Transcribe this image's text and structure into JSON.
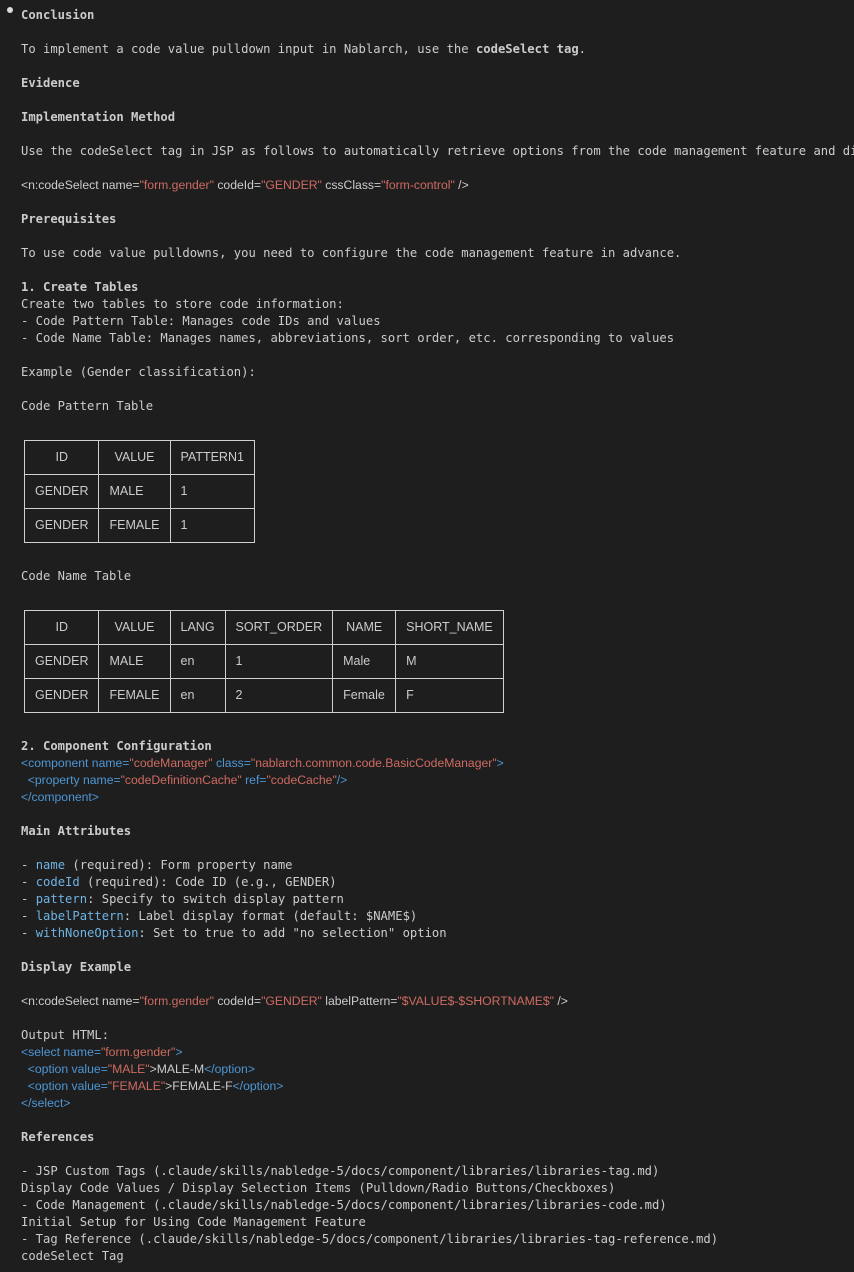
{
  "heading": "Conclusion",
  "intro": {
    "pre": "To implement a code value pulldown input in Nablarch, use the ",
    "tag": "codeSelect tag",
    "post": "."
  },
  "evidence": "Evidence",
  "impl_method": "Implementation Method",
  "impl_text": "Use the codeSelect tag in JSP as follows to automatically retrieve options from the code management feature and display",
  "code1": {
    "open": "<n:codeSelect name=",
    "v1": "\"form.gender\"",
    "a2": " codeId=",
    "v2": "\"GENDER\"",
    "a3": " cssClass=",
    "v3": "\"form-control\"",
    "close": " />"
  },
  "prerequisites": "Prerequisites",
  "prereq_text": "To use code value pulldowns, you need to configure the code management feature in advance.",
  "step1": "1. Create Tables",
  "step1_lines": [
    "Create two tables to store code information:",
    "- Code Pattern Table: Manages code IDs and values",
    "- Code Name Table: Manages names, abbreviations, sort order, etc. corresponding to values"
  ],
  "example_label": "Example (Gender classification):",
  "pattern_table": {
    "title": "Code Pattern Table",
    "headers": [
      "ID",
      "VALUE",
      "PATTERN1"
    ],
    "rows": [
      [
        "GENDER",
        "MALE",
        "1"
      ],
      [
        "GENDER",
        "FEMALE",
        "1"
      ]
    ]
  },
  "name_table": {
    "title": "Code Name Table",
    "headers": [
      "ID",
      "VALUE",
      "LANG",
      "SORT_ORDER",
      "NAME",
      "SHORT_NAME"
    ],
    "rows": [
      [
        "GENDER",
        "MALE",
        "en",
        "1",
        "Male",
        "M"
      ],
      [
        "GENDER",
        "FEMALE",
        "en",
        "2",
        "Female",
        "F"
      ]
    ]
  },
  "step2": "2. Component Configuration",
  "xml": {
    "l1_tag": "<component",
    "l1_a1": " name=",
    "l1_v1": "\"codeManager\"",
    "l1_a2": " class=",
    "l1_v2": "\"nablarch.common.code.BasicCodeManager\"",
    "l1_end": ">",
    "l2_tag": "  <property",
    "l2_a1": " name=",
    "l2_v1": "\"codeDefinitionCache\"",
    "l2_a2": " ref=",
    "l2_v2": "\"codeCache\"",
    "l2_end": "/>",
    "l3": "</component>"
  },
  "main_attrs": "Main Attributes",
  "attrs": [
    {
      "name": "name",
      "desc": " (required): Form property name"
    },
    {
      "name": "codeId",
      "desc": " (required): Code ID (e.g., GENDER)"
    },
    {
      "name": "pattern",
      "desc": ": Specify to switch display pattern"
    },
    {
      "name": "labelPattern",
      "desc": ": Label display format (default: $NAME$)"
    },
    {
      "name": "withNoneOption",
      "desc": ": Set to true to add \"no selection\" option"
    }
  ],
  "display_example": "Display Example",
  "code2": {
    "open": "<n:codeSelect name=",
    "v1": "\"form.gender\"",
    "a2": " codeId=",
    "v2": "\"GENDER\"",
    "a3": " labelPattern=",
    "v3": "\"$VALUE$-$SHORTNAME$\"",
    "close": " />"
  },
  "output_html": "Output HTML:",
  "out": {
    "l1_tag": "<select",
    "l1_a": " name=",
    "l1_v": "\"form.gender\"",
    "l1_end": ">",
    "l2_tag": "  <option",
    "l2_a": " value=",
    "l2_v": "\"MALE\"",
    "l2_text": ">MALE-M",
    "l2_close": "</option>",
    "l3_tag": "  <option",
    "l3_a": " value=",
    "l3_v": "\"FEMALE\"",
    "l3_text": ">FEMALE-F",
    "l3_close": "</option>",
    "l4": "</select>"
  },
  "references": "References",
  "refs": [
    "- JSP Custom Tags (.claude/skills/nabledge-5/docs/component/libraries/libraries-tag.md)",
    "Display Code Values / Display Selection Items (Pulldown/Radio Buttons/Checkboxes)",
    "- Code Management (.claude/skills/nabledge-5/docs/component/libraries/libraries-code.md)",
    "Initial Setup for Using Code Management Feature",
    "- Tag Reference (.claude/skills/nabledge-5/docs/component/libraries/libraries-tag-reference.md)",
    "codeSelect Tag"
  ]
}
